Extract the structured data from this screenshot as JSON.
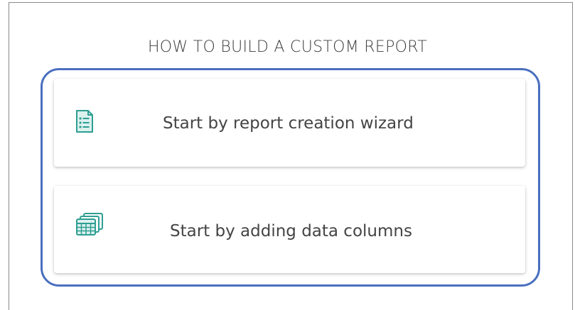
{
  "heading": "HOW TO BUILD A CUSTOM REPORT",
  "options": [
    {
      "label": "Start by report creation wizard",
      "icon": "report-list-icon"
    },
    {
      "label": "Start by adding data columns",
      "icon": "data-columns-icon"
    }
  ],
  "colors": {
    "highlight": "#4a6fbf",
    "icon": "#2e9e92",
    "icon_fill": "#dcf1ee",
    "text": "#444444"
  }
}
